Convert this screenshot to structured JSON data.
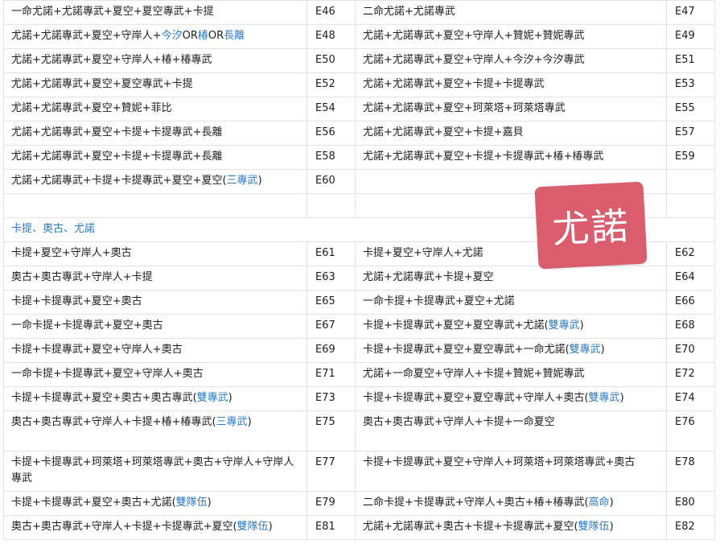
{
  "rows": [
    {
      "kind": "pair",
      "h": 30,
      "left": [
        {
          "t": "一命尤諾+尤諾專武+夏空+夏空專武+卡提"
        }
      ],
      "lc": "E46",
      "right": [
        {
          "t": "二命尤諾+尤諾專武"
        }
      ],
      "rc": "E47"
    },
    {
      "kind": "pair",
      "h": 30,
      "left": [
        {
          "t": "尤諾+尤諾專武+夏空+守岸人+"
        },
        {
          "t": "今汐",
          "c": "blue"
        },
        {
          "t": "OR"
        },
        {
          "t": "椿",
          "c": "blue"
        },
        {
          "t": "OR"
        },
        {
          "t": "長離",
          "c": "blue"
        }
      ],
      "lc": "E48",
      "right": [
        {
          "t": "尤諾+尤諾專武+夏空+守岸人+贊妮+贊妮專武"
        }
      ],
      "rc": "E49"
    },
    {
      "kind": "pair",
      "h": 30,
      "left": [
        {
          "t": "尤諾+尤諾專武+夏空+守岸人+椿+椿專武"
        }
      ],
      "lc": "E50",
      "right": [
        {
          "t": "尤諾+尤諾專武+夏空+守岸人+今汐+今汐專武"
        }
      ],
      "rc": "E51"
    },
    {
      "kind": "pair",
      "h": 30,
      "left": [
        {
          "t": "尤諾+尤諾專武+夏空+夏空專武+卡提"
        }
      ],
      "lc": "E52",
      "right": [
        {
          "t": "尤諾+尤諾專武+夏空+卡提+卡提專武"
        }
      ],
      "rc": "E53"
    },
    {
      "kind": "pair",
      "h": 30,
      "left": [
        {
          "t": "尤諾+尤諾專武+夏空+贊妮+菲比"
        }
      ],
      "lc": "E54",
      "right": [
        {
          "t": "尤諾+尤諾專武+夏空+珂萊塔+珂萊塔專武"
        }
      ],
      "rc": "E55"
    },
    {
      "kind": "pair",
      "h": 30,
      "left": [
        {
          "t": "尤諾+尤諾專武+夏空+卡提+卡提專武+長離"
        }
      ],
      "lc": "E56",
      "right": [
        {
          "t": "尤諾+尤諾專武+夏空+卡提+嘉貝"
        }
      ],
      "rc": "E57"
    },
    {
      "kind": "pair",
      "h": 30,
      "left": [
        {
          "t": "尤諾+尤諾專武+夏空+卡提+卡提專武+長離"
        }
      ],
      "lc": "E58",
      "right": [
        {
          "t": "尤諾+尤諾專武+夏空+卡提+卡提專武+椿+椿專武"
        }
      ],
      "rc": "E59"
    },
    {
      "kind": "pair",
      "h": 30,
      "left": [
        {
          "t": "尤諾+尤諾專武+卡提+卡提專武+夏空+夏空("
        },
        {
          "t": "三專武",
          "c": "blue"
        },
        {
          "t": ")"
        }
      ],
      "lc": "E60",
      "right": [],
      "rc": ""
    },
    {
      "kind": "pair",
      "h": 30,
      "left": [],
      "lc": "",
      "right": [],
      "rc": ""
    },
    {
      "kind": "section",
      "title": "卡提、奧古、尤諾"
    },
    {
      "kind": "pair",
      "h": 30,
      "left": [
        {
          "t": "卡提+夏空+守岸人+奧古"
        }
      ],
      "lc": "E61",
      "right": [
        {
          "t": "卡提+夏空+守岸人+尤諾"
        }
      ],
      "rc": "E62"
    },
    {
      "kind": "pair",
      "h": 30,
      "left": [
        {
          "t": "奧古+奧古專武+守岸人+卡提"
        }
      ],
      "lc": "E63",
      "right": [
        {
          "t": "尤諾+尤諾專武+卡提+夏空"
        }
      ],
      "rc": "E64"
    },
    {
      "kind": "pair",
      "h": 30,
      "left": [
        {
          "t": "卡提+卡提專武+夏空+奧古"
        }
      ],
      "lc": "E65",
      "right": [
        {
          "t": "一命卡提+卡提專武+夏空+尤諾"
        }
      ],
      "rc": "E66"
    },
    {
      "kind": "pair",
      "h": 30,
      "left": [
        {
          "t": "一命卡提+卡提專武+夏空+奧古"
        }
      ],
      "lc": "E67",
      "right": [
        {
          "t": "卡提+卡提專武+夏空+夏空專武+尤諾("
        },
        {
          "t": "雙專武",
          "c": "blue"
        },
        {
          "t": ")"
        }
      ],
      "rc": "E68"
    },
    {
      "kind": "pair",
      "h": 30,
      "left": [
        {
          "t": "卡提+卡提專武+夏空+守岸人+奧古"
        }
      ],
      "lc": "E69",
      "right": [
        {
          "t": "卡提+卡提專武+夏空+夏空專武+一命尤諾("
        },
        {
          "t": "雙專武",
          "c": "blue"
        },
        {
          "t": ")"
        }
      ],
      "rc": "E70"
    },
    {
      "kind": "pair",
      "h": 30,
      "left": [
        {
          "t": "一命卡提+卡提專武+夏空+守岸人+奧古"
        }
      ],
      "lc": "E71",
      "right": [
        {
          "t": "尤諾+一命夏空+守岸人+卡提+贊妮+贊妮專武"
        }
      ],
      "rc": "E72"
    },
    {
      "kind": "pair",
      "h": 30,
      "left": [
        {
          "t": "卡提+卡提專武+夏空+奧古+奧古專武("
        },
        {
          "t": "雙專武",
          "c": "blue"
        },
        {
          "t": ")"
        }
      ],
      "lc": "E73",
      "right": [
        {
          "t": "卡提+卡提專武+夏空+夏空專武+守岸人+奧古("
        },
        {
          "t": "雙專武",
          "c": "blue"
        },
        {
          "t": ")"
        }
      ],
      "rc": "E74"
    },
    {
      "kind": "pair",
      "h": 50,
      "left": [
        {
          "t": "奧古+奧古專武+守岸人+卡提+椿+椿專武("
        },
        {
          "t": "三專武",
          "c": "blue"
        },
        {
          "t": ")"
        }
      ],
      "lc": "E75",
      "right": [
        {
          "t": "奧古+奧古專武+守岸人+卡提+一命夏空"
        }
      ],
      "rc": "E76"
    },
    {
      "kind": "pair",
      "h": 50,
      "left": [
        {
          "t": "卡提+卡提專武+珂萊塔+珂萊塔專武+奧古+守岸人+守岸人專武"
        }
      ],
      "lc": "E77",
      "right": [
        {
          "t": "卡提+卡提專武+夏空+守岸人+珂萊塔+珂萊塔專武+奧古"
        }
      ],
      "rc": "E78"
    },
    {
      "kind": "pair",
      "h": 30,
      "left": [
        {
          "t": "卡提+卡提專武+夏空+奧古+尤諾("
        },
        {
          "t": "雙隊伍",
          "c": "blue"
        },
        {
          "t": ")"
        }
      ],
      "lc": "E79",
      "right": [
        {
          "t": "二命卡提+卡提專武+守岸人+奧古+椿+椿專武("
        },
        {
          "t": "高命",
          "c": "blue"
        },
        {
          "t": ")"
        }
      ],
      "rc": "E80"
    },
    {
      "kind": "pair",
      "h": 30,
      "left": [
        {
          "t": "奧古+奧古專武+守岸人+卡提+卡提專武+夏空("
        },
        {
          "t": "雙隊伍",
          "c": "blue"
        },
        {
          "t": ")"
        }
      ],
      "lc": "E81",
      "right": [
        {
          "t": "尤諾+尤諾專武+奧古+卡提+卡提專武+夏空("
        },
        {
          "t": "雙隊伍",
          "c": "blue"
        },
        {
          "t": ")"
        }
      ],
      "rc": "E82"
    }
  ],
  "watermark": "尤諾",
  "colors": {
    "link_blue": "#2b7bc9",
    "watermark_bg": "#d95d6c",
    "border": "#e3e3e3"
  }
}
